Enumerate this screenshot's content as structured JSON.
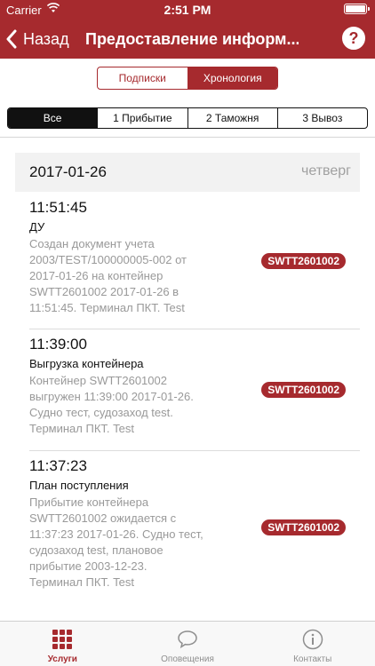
{
  "status_bar": {
    "carrier": "Carrier",
    "time": "2:51 PM"
  },
  "nav": {
    "back_label": "Назад",
    "title": "Предоставление информ...",
    "help_label": "?"
  },
  "segments_top": [
    "Подписки",
    "Хронология"
  ],
  "segments_filter": [
    "Все",
    "1 Прибытие",
    "2 Таможня",
    "3 Вывоз"
  ],
  "date_header": {
    "date": "2017-01-26",
    "weekday": "четверг"
  },
  "entries": [
    {
      "time": "11:51:45",
      "title": "ДУ",
      "desc_lines": [
        "Создан документ учета",
        "2003/TEST/100000005-002 от",
        "2017-01-26 на контейнер",
        "SWTT2601002 2017-01-26 в",
        "11:51:45. Терминал ПКТ. Test"
      ],
      "badge": "SWTT2601002"
    },
    {
      "time": "11:39:00",
      "title": "Выгрузка контейнера",
      "desc_lines": [
        "Контейнер SWTT2601002",
        "выгружен 11:39:00 2017-01-26.",
        "Судно тест, судозаход test.",
        "Терминал ПКТ. Test"
      ],
      "badge": "SWTT2601002"
    },
    {
      "time": "11:37:23",
      "title": "План поступления",
      "desc_lines": [
        "Прибытие контейнера",
        "SWTT2601002 ожидается с",
        "11:37:23 2017-01-26. Судно тест,",
        "судозаход test, плановое",
        "прибытие 2003-12-23.",
        "Терминал ПКТ. Test"
      ],
      "badge": "SWTT2601002"
    }
  ],
  "tabbar": {
    "items": [
      "Услуги",
      "Оповещения",
      "Контакты"
    ],
    "active": "Услуги"
  },
  "colors": {
    "brand": "#a62a2e",
    "muted_text": "#999999",
    "tab_inactive": "#8e8e8e"
  }
}
